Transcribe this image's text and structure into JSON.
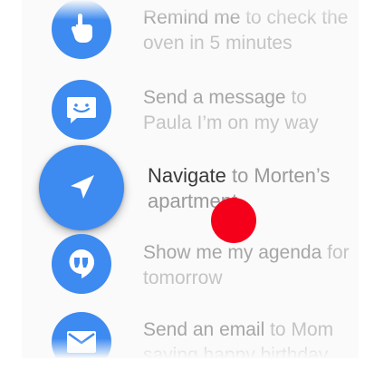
{
  "suggestions": [
    {
      "icon": "hand-pointer-icon",
      "command": "Remind me",
      "rest": " to check the oven in 5 minutes"
    },
    {
      "icon": "message-icon",
      "command": "Send a message",
      "rest": " to Paula I’m on my way"
    },
    {
      "icon": "navigate-icon",
      "command": "Navigate",
      "rest": " to Morten’s apartment"
    },
    {
      "icon": "hangouts-icon",
      "command": "Show me my agenda",
      "rest": " for tomorrow"
    },
    {
      "icon": "email-icon",
      "command": "Send an email",
      "rest": " to Mom saying happy birthday"
    }
  ],
  "colors": {
    "accent": "#3d8af0",
    "touch": "#f4001b"
  }
}
